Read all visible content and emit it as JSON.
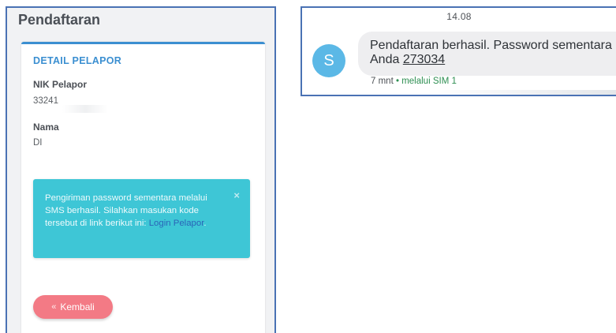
{
  "registration": {
    "page_title": "Pendaftaran",
    "card_header": "DETAIL PELAPOR",
    "nik_label": "NIK Pelapor",
    "nik_value": "33241",
    "name_label": "Nama",
    "name_value": "DI",
    "alert": {
      "text_before": "Pengiriman password sementara melalui SMS berhasil. Silahkan masukan kode tersebut di link berikut ini: ",
      "link_text": "Login Pelapor",
      "text_after": ".",
      "close_icon": "×"
    },
    "back_button": {
      "icon": "«",
      "label": "Kembali"
    }
  },
  "sms": {
    "time": "14.08",
    "avatar_letter": "S",
    "message_prefix": "Pendaftaran berhasil. Password sementara Anda ",
    "code": "273034",
    "age": "7 mnt",
    "separator": "•",
    "via": "melalui SIM 1"
  },
  "colors": {
    "accent_blue": "#3b8fd1",
    "alert_cyan": "#3ec6d6",
    "button_pink": "#f37a85",
    "avatar_blue": "#5bb8e6",
    "sim_green": "#2e8f52",
    "frame_blue": "#4a72b4"
  },
  "icons": {
    "close": "close-icon",
    "back": "double-chevron-left-icon",
    "avatar": "sender-avatar"
  }
}
